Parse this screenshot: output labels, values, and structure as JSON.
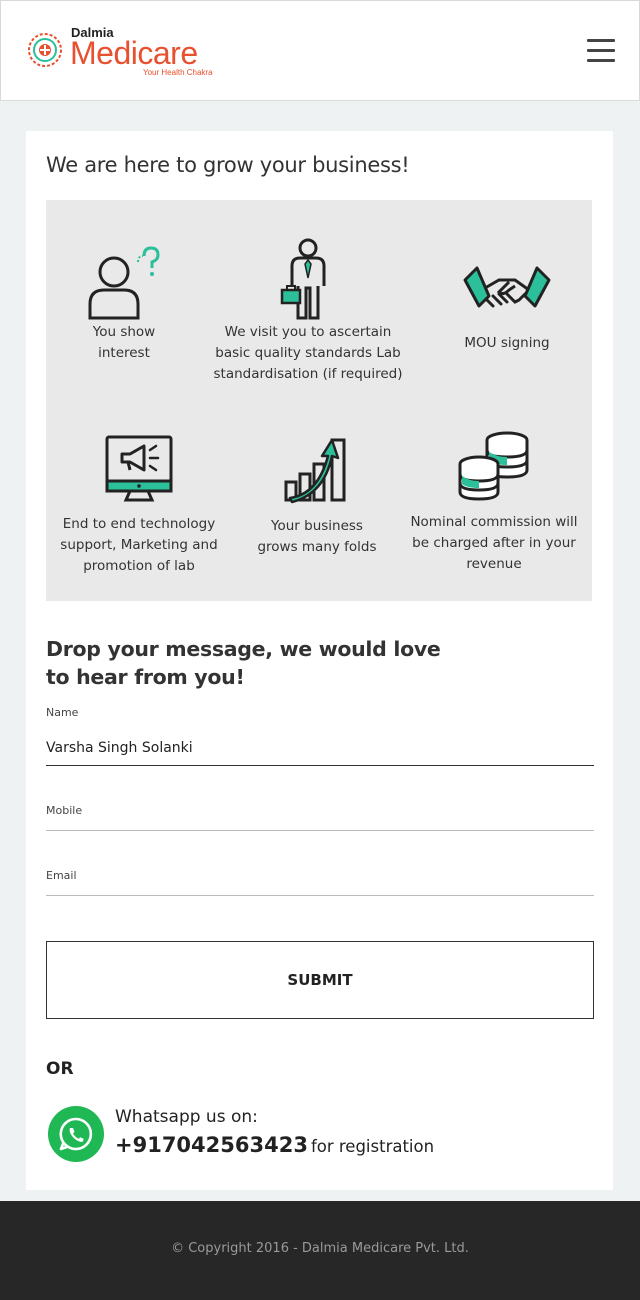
{
  "header": {
    "logo_small": "Dalmia",
    "logo_main": "Medicare",
    "logo_tagline": "Your Health Chakra",
    "menu_icon": "hamburger-menu-icon"
  },
  "main": {
    "title": "We are here to grow your business!",
    "steps": [
      {
        "icon": "person-question-icon",
        "lines": [
          "You show",
          "interest"
        ]
      },
      {
        "icon": "businessman-briefcase-icon",
        "lines": [
          "We visit you to ascertain",
          "basic quality standards Lab",
          "standardisation (if required)"
        ]
      },
      {
        "icon": "handshake-icon",
        "lines": [
          "MOU signing"
        ]
      },
      {
        "icon": "monitor-megaphone-icon",
        "lines": [
          "End to end technology",
          "support, Marketing and",
          "promotion of lab"
        ]
      },
      {
        "icon": "growth-chart-icon",
        "lines": [
          "Your business",
          "grows many folds"
        ]
      },
      {
        "icon": "coins-stack-icon",
        "lines": [
          "Nominal commission will",
          "be charged after in your",
          "revenue"
        ]
      }
    ],
    "accent_color": "#2bbf9a"
  },
  "form": {
    "title": "Drop your message, we would love to hear from you!",
    "name_label": "Name",
    "name_value": "Varsha Singh Solanki",
    "mobile_label": "Mobile",
    "mobile_value": "",
    "email_label": "Email",
    "email_value": "",
    "submit_label": "SUBMIT"
  },
  "contact": {
    "or_label": "OR",
    "whatsapp_label": "Whatsapp us on:",
    "phone": "+917042563423",
    "suffix": "for registration",
    "whatsapp_color": "#1fb855"
  },
  "footer": {
    "copyright": "© Copyright 2016 - Dalmia Medicare Pvt. Ltd."
  }
}
